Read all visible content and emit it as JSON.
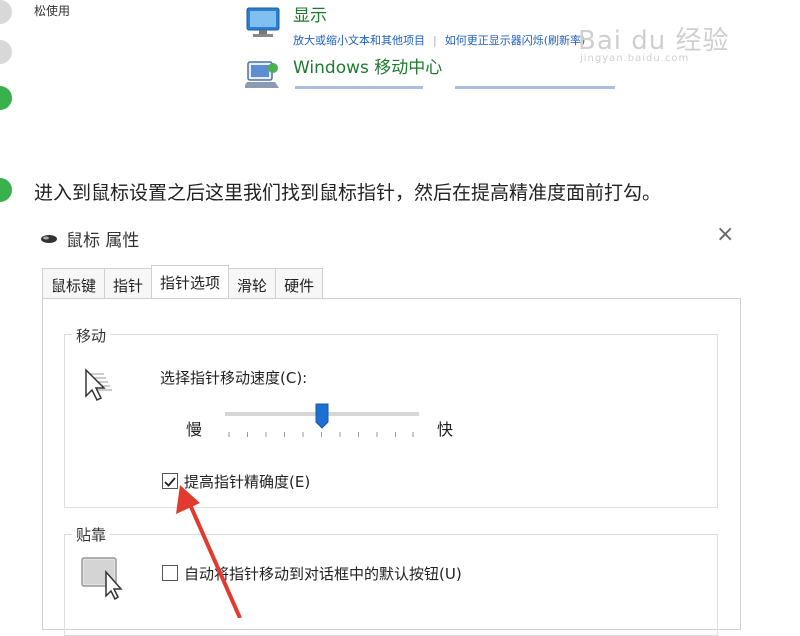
{
  "top_snippet": {
    "left_text": "松使用",
    "display": {
      "title": "显示",
      "link1": "放大或缩小文本和其他项目",
      "link2": "如何更正显示器闪烁(刷新率)"
    },
    "mobility": {
      "title": "Windows 移动中心"
    }
  },
  "watermark": {
    "brand": "Bai du 经验",
    "url": "jingyan.baidu.com"
  },
  "instruction": "进入到鼠标设置之后这里我们找到鼠标指针，然后在提高精准度面前打勾。",
  "dialog": {
    "title": "鼠标 属性",
    "close": "×",
    "tabs": [
      "鼠标键",
      "指针",
      "指针选项",
      "滑轮",
      "硬件"
    ],
    "active_tab_index": 2,
    "motion": {
      "group_label": "移动",
      "speed_label": "选择指针移动速度(C):",
      "slow_label": "慢",
      "fast_label": "快",
      "slider_value_fraction": 0.5,
      "precision_label": "提高指针精确度(E)",
      "precision_checked": true
    },
    "snap": {
      "group_label": "贴靠",
      "snap_label": "自动将指针移动到对话框中的默认按钮(U)",
      "snap_checked": false
    }
  },
  "colors": {
    "link": "#1f5fbf",
    "cp_title": "#1e7a2e",
    "slider_thumb": "#1d6fd1",
    "annotation_arrow": "#e23a2f",
    "step_green": "#37b24d"
  }
}
